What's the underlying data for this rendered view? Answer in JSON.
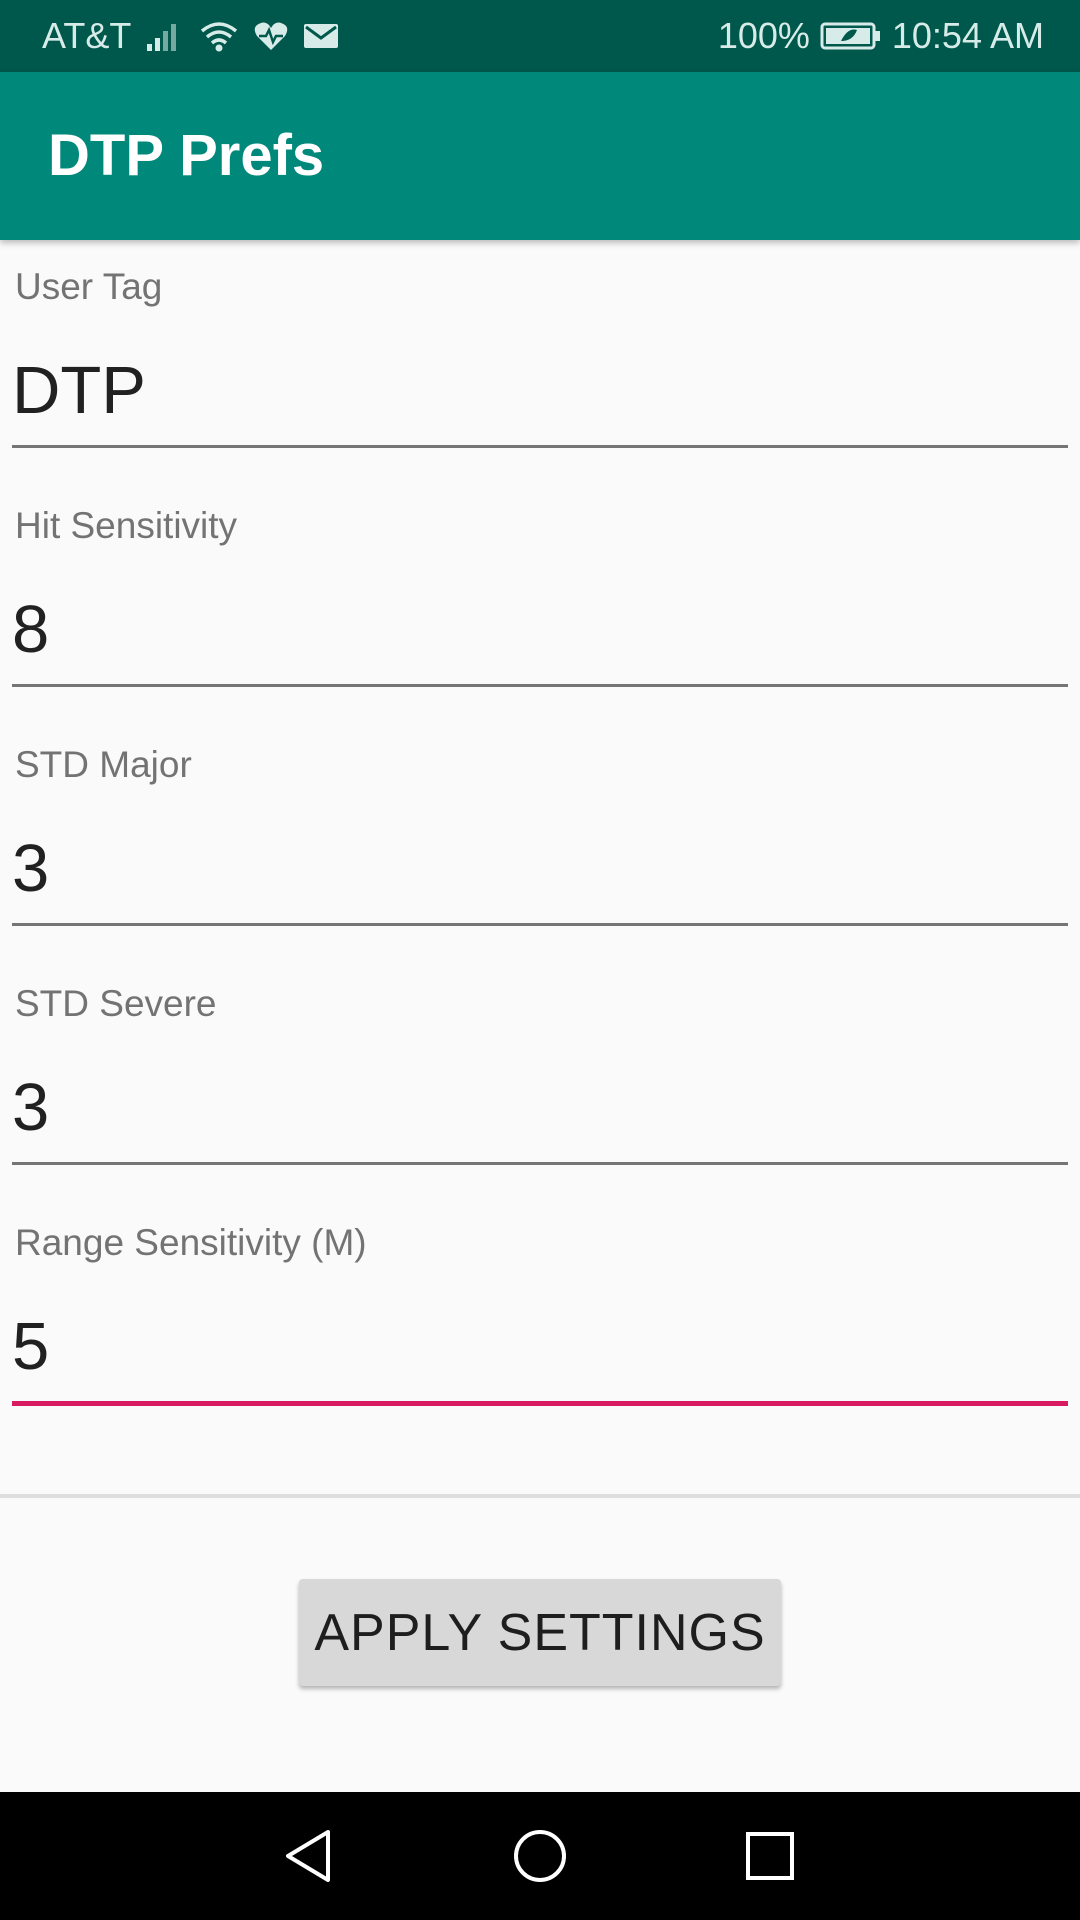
{
  "status_bar": {
    "carrier": "AT&T",
    "battery_percent": "100%",
    "time": "10:54 AM",
    "icons": [
      "signal-icon",
      "wifi-icon",
      "health-icon",
      "mail-icon",
      "battery-icon"
    ]
  },
  "app_bar": {
    "title": "DTP Prefs",
    "color": "#00897b"
  },
  "fields": [
    {
      "label": "User Tag",
      "value": "DTP"
    },
    {
      "label": "Hit Sensitivity",
      "value": "8"
    },
    {
      "label": "STD Major",
      "value": "3"
    },
    {
      "label": "STD Severe",
      "value": "3"
    },
    {
      "label": "Range Sensitivity (M)",
      "value": "5",
      "focused": true
    }
  ],
  "apply_button": {
    "label": "APPLY SETTINGS"
  },
  "nav_bar": {
    "icons": [
      "back-icon",
      "home-icon",
      "recents-icon"
    ]
  },
  "colors": {
    "status_bar": "#00574b",
    "app_bar": "#00897b",
    "accent": "#d81b60",
    "background": "#fafafa"
  }
}
